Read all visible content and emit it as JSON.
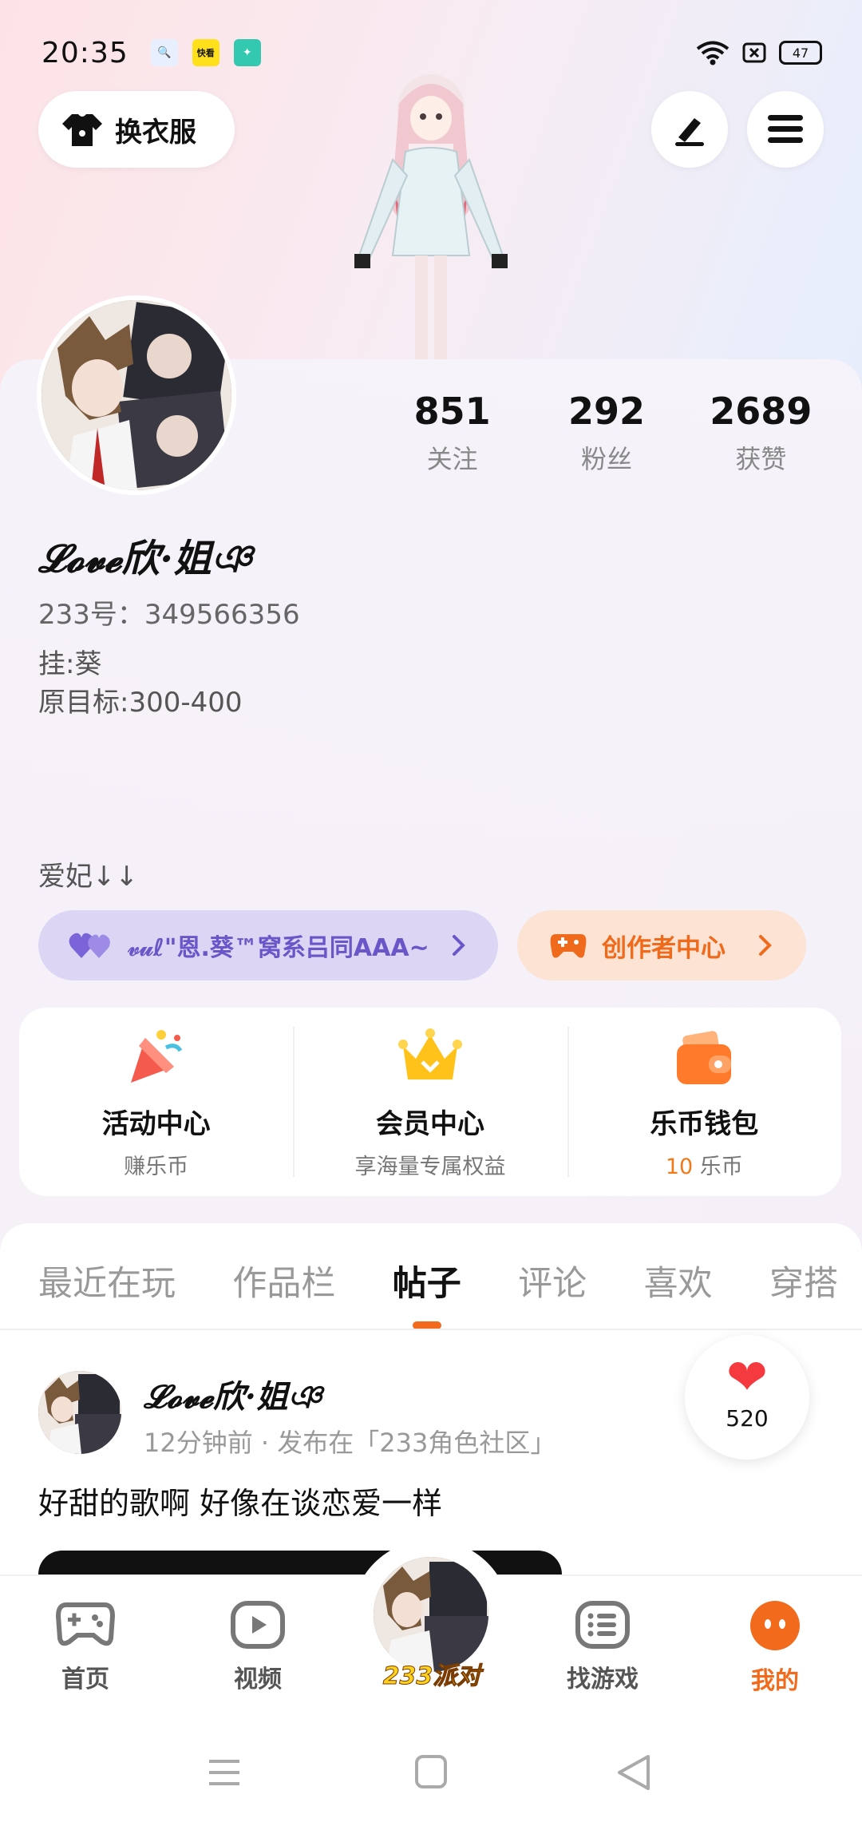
{
  "status_bar": {
    "time": "20:35",
    "battery": "47"
  },
  "top_bar": {
    "dress_button": "换衣服"
  },
  "profile": {
    "stats": [
      {
        "value": "851",
        "label": "关注"
      },
      {
        "value": "292",
        "label": "粉丝"
      },
      {
        "value": "2689",
        "label": "获赞"
      }
    ],
    "nickname": "𝓛𝓸𝓿𝓮欣·姐ঞ",
    "uid": "233号：349566356",
    "bio": "挂:葵\n原目标:300-400",
    "bio2": "爱妃↓↓",
    "fan_chip": "𝓋𝓊ℓ\"恩.葵™窝系吕同AAA~",
    "creator_chip": "创作者中心"
  },
  "services": [
    {
      "title": "活动中心",
      "sub": "赚乐币"
    },
    {
      "title": "会员中心",
      "sub": "享海量专属权益"
    },
    {
      "title": "乐币钱包",
      "sub_value": "10",
      "sub_unit": " 乐币"
    }
  ],
  "tabs": [
    "最近在玩",
    "作品栏",
    "帖子",
    "评论",
    "喜欢",
    "穿搭"
  ],
  "active_tab": "帖子",
  "post": {
    "author": "𝓛𝓸𝓿𝓮欣·姐ঞ",
    "meta": "12分钟前 · 发布在「233角色社区」",
    "text": "好甜的歌啊 好像在谈恋爱一样",
    "likes": "520"
  },
  "bottom_nav": [
    {
      "label": "首页",
      "icon": "gamepad-icon"
    },
    {
      "label": "视频",
      "icon": "video-icon"
    },
    {
      "label": "233派对",
      "icon": "party-avatar"
    },
    {
      "label": "找游戏",
      "icon": "list-icon"
    },
    {
      "label": "我的",
      "icon": "profile-face-icon"
    }
  ],
  "colors": {
    "accent": "#f26a1b",
    "fan_chip": "#6a56c8",
    "like": "#f43a3e"
  }
}
